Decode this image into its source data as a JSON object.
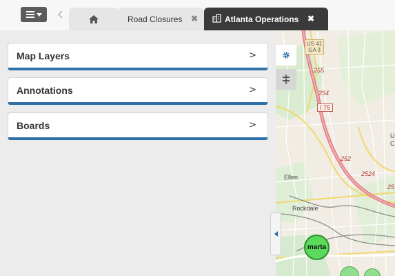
{
  "header": {
    "tabs": [
      {
        "label": "",
        "icon": "home-icon"
      },
      {
        "label": "Road Closures",
        "close_icon": "✖"
      },
      {
        "label": "Atlanta Operations",
        "close_icon": "✖",
        "icon": "building-icon",
        "active": true
      }
    ]
  },
  "panel": {
    "sections": [
      {
        "label": "Map Layers",
        "chevron": ">"
      },
      {
        "label": "Annotations",
        "chevron": ">"
      },
      {
        "label": "Boards",
        "chevron": ">"
      }
    ]
  },
  "map": {
    "shield_us41": "US 41",
    "shield_ga3": "GA 3",
    "road_255": "255",
    "road_254": "254",
    "i175": "I 75",
    "road_252": "252",
    "road_2524": "2524",
    "road_25": "25",
    "place_ellen": "Ellen",
    "place_rockdale": "Rockdale",
    "edge_u": "U",
    "edge_c": "C",
    "marta": "marta"
  },
  "colors": {
    "accent_blue": "#2e70a8",
    "active_tab": "#3a3a3a",
    "marta_green": "#5ad95a"
  }
}
